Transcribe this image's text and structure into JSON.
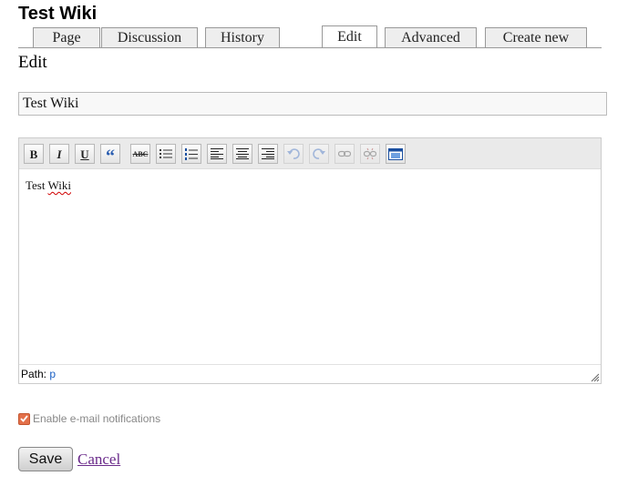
{
  "page": {
    "title": "Test Wiki"
  },
  "tabs": [
    {
      "label": "Page",
      "active": false
    },
    {
      "label": "Discussion",
      "active": false
    },
    {
      "label": "History",
      "active": false
    },
    {
      "label": "Edit",
      "active": true
    },
    {
      "label": "Advanced",
      "active": false
    },
    {
      "label": "Create new",
      "active": false
    }
  ],
  "section": {
    "title": "Edit"
  },
  "form": {
    "title_value": "Test Wiki"
  },
  "editor": {
    "toolbar": [
      {
        "name": "bold",
        "icon": "bold-icon",
        "label": "B"
      },
      {
        "name": "italic",
        "icon": "italic-icon",
        "label": "I"
      },
      {
        "name": "underline",
        "icon": "underline-icon",
        "label": "U"
      },
      {
        "name": "blockquote",
        "icon": "quote-icon",
        "label": "“"
      },
      {
        "name": "strikethrough",
        "icon": "strikethrough-icon",
        "label": "ABC"
      },
      {
        "name": "bullet-list",
        "icon": "bullet-list-icon"
      },
      {
        "name": "numbered-list",
        "icon": "numbered-list-icon"
      },
      {
        "name": "align-left",
        "icon": "align-left-icon"
      },
      {
        "name": "align-center",
        "icon": "align-center-icon"
      },
      {
        "name": "align-right",
        "icon": "align-right-icon"
      },
      {
        "name": "undo",
        "icon": "undo-icon",
        "disabled": true
      },
      {
        "name": "redo",
        "icon": "redo-icon",
        "disabled": true
      },
      {
        "name": "link",
        "icon": "link-icon",
        "disabled": true
      },
      {
        "name": "unlink",
        "icon": "unlink-icon",
        "disabled": true
      },
      {
        "name": "html-source",
        "icon": "html-source-icon"
      }
    ],
    "content": "Test Wiki",
    "path_label": "Path:",
    "path_value": "p"
  },
  "notifications": {
    "label": "Enable e-mail notifications",
    "checked": true
  },
  "actions": {
    "save_label": "Save",
    "cancel_label": "Cancel"
  },
  "colors": {
    "checkbox": "#e3704a",
    "link": "#1a5fc4",
    "visited_link": "#6a2a8a"
  }
}
